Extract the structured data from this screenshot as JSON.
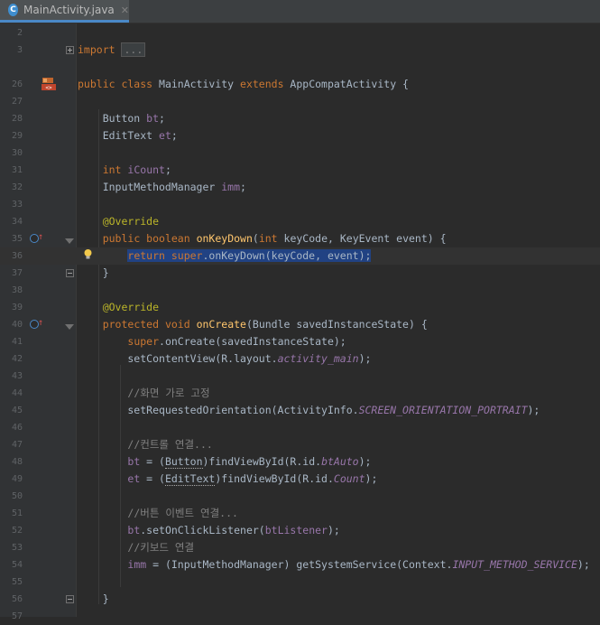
{
  "tab": {
    "icon_letter": "C",
    "title": "MainActivity.java",
    "close": "✕"
  },
  "lines": [
    {
      "n": "2",
      "html": ""
    },
    {
      "n": "3",
      "html": "<span class=\"kw\">import</span> <span class=\"fold-box\">...</span>"
    },
    {
      "n": "",
      "html": ""
    },
    {
      "n": "26",
      "html": "<span class=\"kw\">public class</span> MainActivity <span class=\"kw\">extends</span> AppCompatActivity {"
    },
    {
      "n": "27",
      "html": ""
    },
    {
      "n": "28",
      "html": "    Button <span class=\"fld\">bt</span>;"
    },
    {
      "n": "29",
      "html": "    EditText <span class=\"fld\">et</span>;"
    },
    {
      "n": "30",
      "html": ""
    },
    {
      "n": "31",
      "html": "    <span class=\"kw\">int</span> <span class=\"fld\">iCount</span>;"
    },
    {
      "n": "32",
      "html": "    InputMethodManager <span class=\"fld\">imm</span>;"
    },
    {
      "n": "33",
      "html": ""
    },
    {
      "n": "34",
      "html": "    <span class=\"ann\">@Override</span>"
    },
    {
      "n": "35",
      "html": "    <span class=\"kw\">public boolean</span> <span class=\"mth\">onKeyDown</span>(<span class=\"kw\">int</span> keyCode, KeyEvent event) {"
    },
    {
      "n": "36",
      "html": "        <span class=\"sel\"><span class=\"kw\">return super</span>.onKeyDown(keyCode, event);</span>"
    },
    {
      "n": "37",
      "html": "    }"
    },
    {
      "n": "38",
      "html": ""
    },
    {
      "n": "39",
      "html": "    <span class=\"ann\">@Override</span>"
    },
    {
      "n": "40",
      "html": "    <span class=\"kw\">protected void</span> <span class=\"mth\">onCreate</span>(Bundle savedInstanceState) {"
    },
    {
      "n": "41",
      "html": "        <span class=\"kw\">super</span>.onCreate(savedInstanceState);"
    },
    {
      "n": "42",
      "html": "        setContentView(R.layout.<span class=\"cnst\">activity_main</span>);"
    },
    {
      "n": "43",
      "html": ""
    },
    {
      "n": "44",
      "html": "        <span class=\"cmt\">//화면 가로 고정</span>"
    },
    {
      "n": "45",
      "html": "        setRequestedOrientation(ActivityInfo.<span class=\"cnst\">SCREEN_ORIENTATION_PORTRAIT</span>);"
    },
    {
      "n": "46",
      "html": ""
    },
    {
      "n": "47",
      "html": "        <span class=\"cmt\">//컨트롤 연결...</span>"
    },
    {
      "n": "48",
      "html": "        <span class=\"fld\">bt</span> = (<span class=\"cast\">Button</span>)findViewById(R.id.<span class=\"cnst\">btAuto</span>);"
    },
    {
      "n": "49",
      "html": "        <span class=\"fld\">et</span> = (<span class=\"cast\">EditText</span>)findViewById(R.id.<span class=\"cnst\">Count</span>);"
    },
    {
      "n": "50",
      "html": ""
    },
    {
      "n": "51",
      "html": "        <span class=\"cmt\">//버튼 이벤트 연결...</span>"
    },
    {
      "n": "52",
      "html": "        <span class=\"fld\">bt</span>.setOnClickListener(<span class=\"fld\">btListener</span>);"
    },
    {
      "n": "53",
      "html": "        <span class=\"cmt\">//키보드 연결</span>"
    },
    {
      "n": "54",
      "html": "        <span class=\"fld\">imm</span> = (InputMethodManager) getSystemService(Context.<span class=\"cnst\">INPUT_METHOD_SERVICE</span>);"
    },
    {
      "n": "55",
      "html": ""
    },
    {
      "n": "56",
      "html": "    }"
    },
    {
      "n": "57",
      "html": ""
    }
  ],
  "colors": {
    "background": "#2b2b2b",
    "keyword": "#cc7832",
    "annotation": "#bbb529",
    "field": "#9876aa",
    "method": "#ffc66d",
    "comment": "#808080",
    "selection": "#214283"
  }
}
